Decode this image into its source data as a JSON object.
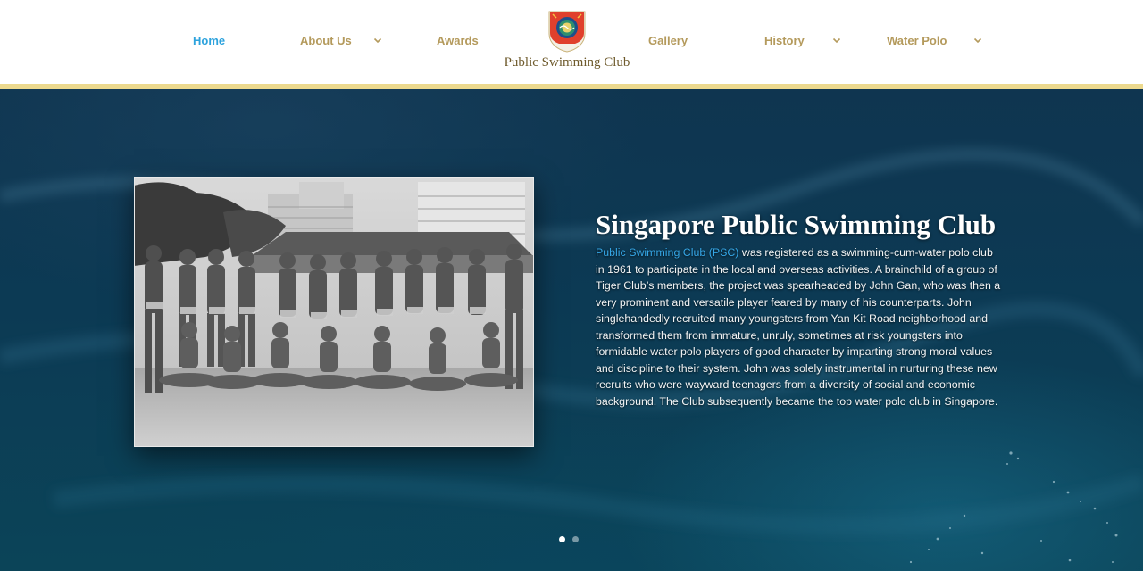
{
  "nav": {
    "items": [
      {
        "label": "Home",
        "active": true,
        "has_dropdown": false
      },
      {
        "label": "About Us",
        "active": false,
        "has_dropdown": true
      },
      {
        "label": "Awards",
        "active": false,
        "has_dropdown": false
      },
      {
        "label": "Gallery",
        "active": false,
        "has_dropdown": false
      },
      {
        "label": "History",
        "active": false,
        "has_dropdown": true
      },
      {
        "label": "Water Polo",
        "active": false,
        "has_dropdown": true
      }
    ]
  },
  "logo": {
    "text": "Public Swimming Club",
    "icon": "club-crest-icon"
  },
  "colors": {
    "nav_text": "#b49a5c",
    "nav_active": "#2ea3dd",
    "header_rule": "#ecd98e",
    "hero_bg": "#0c3a54",
    "link": "#35a6e6"
  },
  "hero": {
    "title": "Singapore Public Swimming Club",
    "link_text": "Public Swimming Club (PSC)",
    "body_lines": [
      " was registered as a swimming-cum-water polo club",
      "in 1961 to participate in the local and overseas activities. A brainchild of a group of",
      "Tiger Club’s members, the project was spearheaded by John Gan, who was then a",
      "very prominent and versatile player feared by many of his counterparts. John",
      "singlehandedly recruited many youngsters from Yan Kit Road neighborhood and",
      "transformed them from immature, unruly, sometimes at risk youngsters into",
      "formidable water polo players of good character by imparting strong moral values",
      "and discipline to their system. John was solely instrumental in nurturing these new",
      "recruits who were wayward teenagers from a diversity of social and economic",
      "background. The Club subsequently became the top water polo club in Singapore."
    ],
    "photo_icon": "team-photo-image"
  },
  "slider": {
    "count": 2,
    "active_index": 0
  }
}
